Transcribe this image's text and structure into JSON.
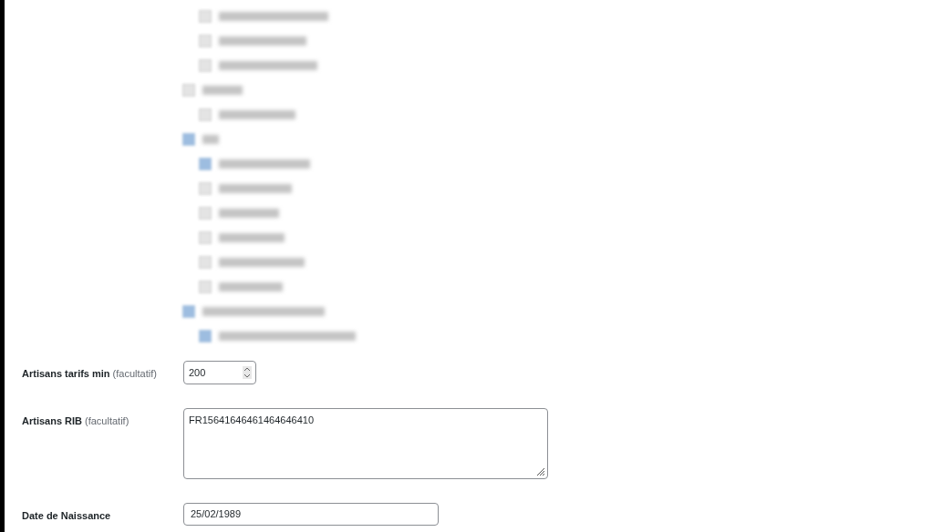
{
  "category_tree": [
    {
      "kind": "continued",
      "children": [
        {
          "checked": false
        },
        {
          "checked": false
        },
        {
          "checked": false
        }
      ]
    },
    {
      "kind": "row",
      "checked": false,
      "children": [
        {
          "checked": false
        }
      ]
    },
    {
      "kind": "row",
      "checked": true,
      "children": [
        {
          "checked": true
        },
        {
          "checked": false
        },
        {
          "checked": false
        },
        {
          "checked": false
        },
        {
          "checked": false
        },
        {
          "checked": false
        }
      ]
    },
    {
      "kind": "row",
      "checked": true,
      "children": [
        {
          "checked": true
        }
      ]
    }
  ],
  "fields": [
    {
      "kind": "number",
      "label": "Artisans tarifs min",
      "hint": "(facultatif)",
      "value": "200"
    },
    {
      "kind": "textarea",
      "label": "Artisans RIB",
      "hint": "(facultatif)",
      "value": "FR15641646461464646410"
    },
    {
      "kind": "text",
      "label": "Date de Naissance",
      "value": "25/02/1989"
    }
  ]
}
